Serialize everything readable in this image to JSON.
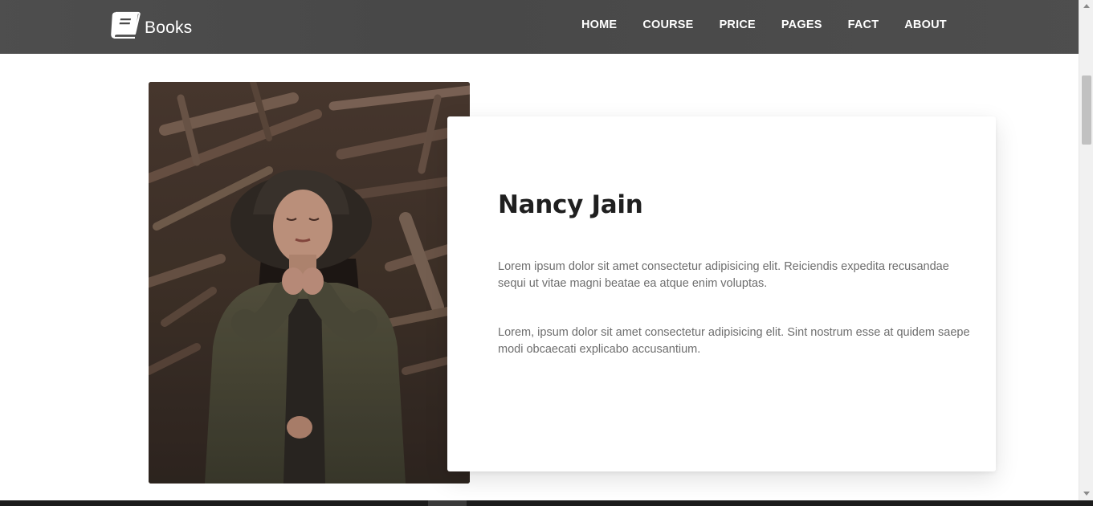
{
  "header": {
    "brand": "Books",
    "brand_icon": "book-icon",
    "nav": [
      {
        "label": "HOME"
      },
      {
        "label": "COURSE"
      },
      {
        "label": "PRICE"
      },
      {
        "label": "PAGES"
      },
      {
        "label": "FACT"
      },
      {
        "label": "ABOUT"
      }
    ]
  },
  "profile": {
    "name": "Nancy Jain",
    "paragraphs": [
      "Lorem ipsum dolor sit amet consectetur adipisicing elit. Reiciendis expedita recusandae sequi ut vitae magni beatae ea atque enim voluptas.",
      "Lorem, ipsum dolor sit amet consectetur adipisicing elit. Sint nostrum esse at quidem saepe modi obcaecati explicabo accusantium."
    ]
  },
  "colors": {
    "navbar_bg": "#4a4a4a",
    "nav_text": "#ffffff",
    "title_text": "#1f1f1f",
    "body_text": "#6e6e6e"
  }
}
